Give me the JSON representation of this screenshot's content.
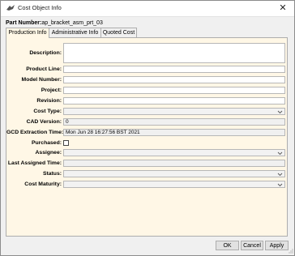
{
  "window": {
    "title": "Cost Object Info",
    "close_glyph": "✕"
  },
  "part": {
    "label": "Part Number:",
    "value": "ap_bracket_asm_prt_03"
  },
  "tabs": [
    {
      "label": "Production Info",
      "active": true
    },
    {
      "label": "Administrative Info",
      "active": false
    },
    {
      "label": "Quoted Cost",
      "active": false
    }
  ],
  "form": {
    "description": {
      "label": "Description:",
      "value": ""
    },
    "product_line": {
      "label": "Product Line:",
      "value": ""
    },
    "model_number": {
      "label": "Model Number:",
      "value": ""
    },
    "project": {
      "label": "Project:",
      "value": ""
    },
    "revision": {
      "label": "Revision:",
      "value": ""
    },
    "cost_type": {
      "label": "Cost Type:",
      "value": ""
    },
    "cad_version": {
      "label": "CAD Version:",
      "value": "0"
    },
    "gcd_extraction_time": {
      "label": "GCD Extraction Time:",
      "value": "Mon Jun 28 16:27:56 BST 2021"
    },
    "purchased": {
      "label": "Purchased:",
      "checked": false
    },
    "assignee": {
      "label": "Assignee:",
      "value": ""
    },
    "last_assigned_time": {
      "label": "Last Assigned Time:",
      "value": ""
    },
    "status": {
      "label": "Status:",
      "value": ""
    },
    "cost_maturity": {
      "label": "Cost Maturity:",
      "value": ""
    }
  },
  "buttons": {
    "ok": "OK",
    "cancel": "Cancel",
    "apply": "Apply"
  },
  "colors": {
    "panel_bg": "#fff7e6",
    "window_bg": "#f0f0f0"
  }
}
